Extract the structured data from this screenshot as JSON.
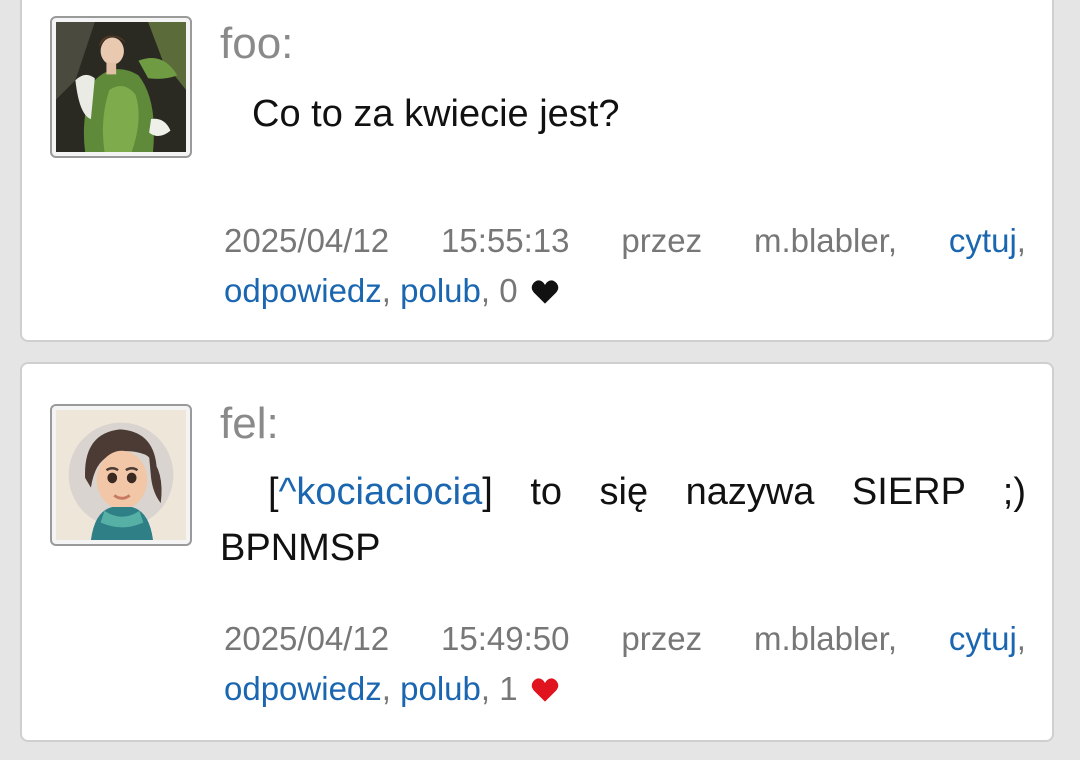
{
  "posts": [
    {
      "username": "foo:",
      "message": "Co to za kwiecie jest?",
      "date": "2025/04/12",
      "time": "15:55:13",
      "by_label": "przez",
      "author": "m.blabler,",
      "quote_label": "cytuj",
      "reply_label": "odpowiedz",
      "like_label": "polub",
      "like_count": "0",
      "heart_icon": "heart-icon",
      "heart_color": "#111111"
    },
    {
      "username": "fel:",
      "mention_open": "[",
      "mention": "^kociaciocia",
      "mention_close": "]",
      "message_rest": " to się nazywa SIERP ;) BPNMSP",
      "date": "2025/04/12",
      "time": "15:49:50",
      "by_label": "przez",
      "author": "m.blabler,",
      "quote_label": "cytuj",
      "reply_label": "odpowiedz",
      "like_label": "polub",
      "like_count": "1",
      "heart_icon": "heart-icon",
      "heart_color": "#e0141e"
    }
  ],
  "colors": {
    "link": "#1a66b0",
    "meta": "#777777",
    "username": "#8a8a8a",
    "background": "#e5e5e5"
  }
}
